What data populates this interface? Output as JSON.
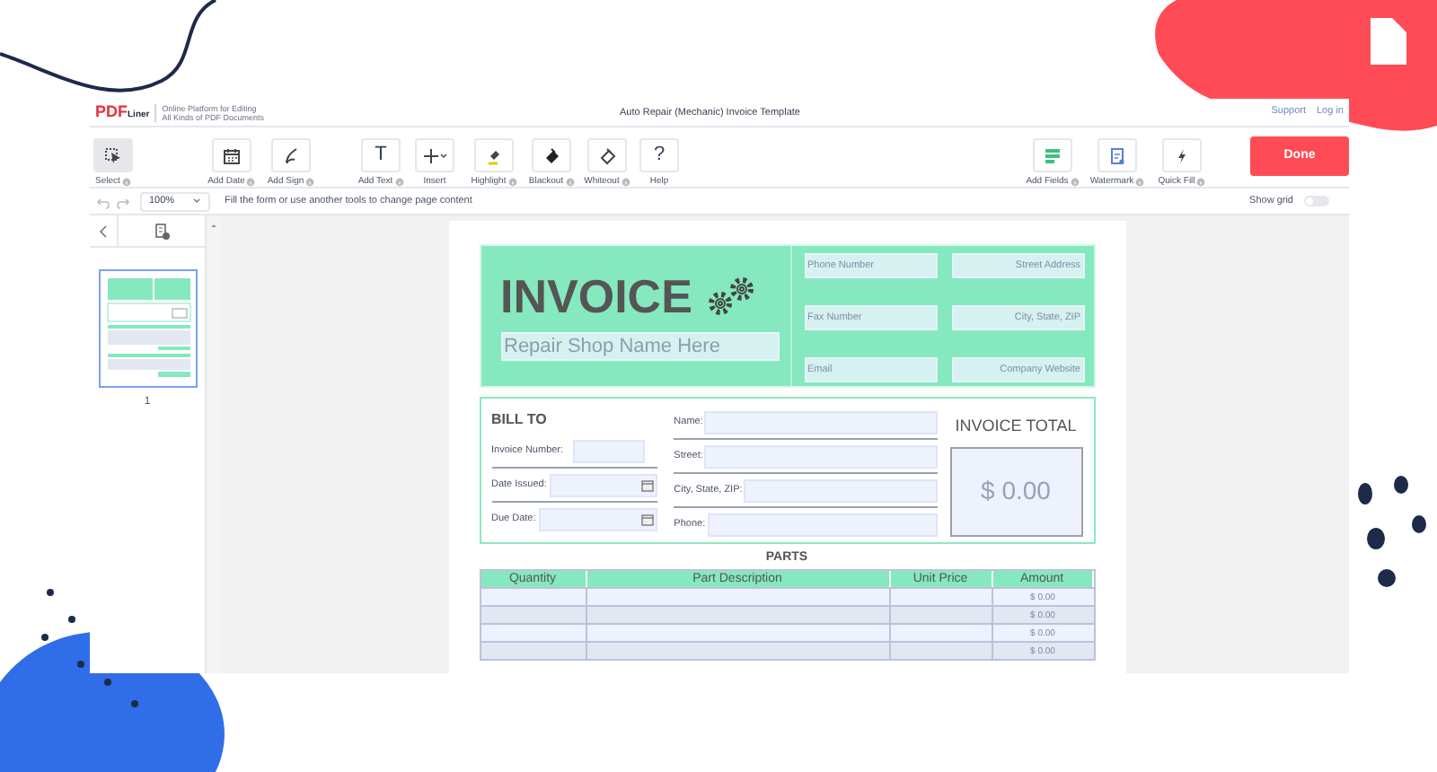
{
  "app_header": {
    "logo": "PDF",
    "logo_suffix": "Liner",
    "tagline": [
      "Online Platform for Editing",
      "All Kinds of PDF Documents"
    ],
    "document_title": "Auto Repair (Mechanic) Invoice Template",
    "links": [
      "Support",
      "Log in"
    ]
  },
  "toolbar": {
    "tools": [
      {
        "kind": "select",
        "label": "Select",
        "info": true,
        "selected": true
      },
      {
        "kind": "date",
        "label": "Add Date",
        "info": true,
        "selected": false
      },
      {
        "kind": "sign",
        "label": "Add Sign",
        "info": true,
        "selected": false
      },
      {
        "kind": "text",
        "label": "Add Text",
        "glyph": "T",
        "info": true,
        "selected": false
      },
      {
        "kind": "insert",
        "label": "Insert",
        "info": false,
        "selected": false
      },
      {
        "kind": "highlight",
        "label": "Highlight",
        "info": true,
        "selected": false
      },
      {
        "kind": "blackout",
        "label": "Blackout",
        "info": true,
        "selected": false
      },
      {
        "kind": "whiteout",
        "label": "Whiteout",
        "info": true,
        "selected": false
      },
      {
        "kind": "help",
        "label": "Help",
        "glyph": "?",
        "info": false,
        "selected": false
      }
    ],
    "right_tools": [
      {
        "kind": "fields",
        "label": "Add Fields",
        "info": true,
        "selected": false
      },
      {
        "kind": "watermark",
        "label": "Watermark",
        "info": true,
        "selected": false
      },
      {
        "kind": "quickfill",
        "label": "Quick Fill",
        "info": true,
        "selected": false
      }
    ],
    "done": "Done"
  },
  "subbar": {
    "zoom": "100%",
    "hint": "Fill the form or use another tools to change page content",
    "show_grid": {
      "label": "Show grid",
      "on": false
    }
  },
  "pages": [
    {
      "label": "1",
      "selected": true
    }
  ],
  "invoice": {
    "title": "INVOICE",
    "shop_name": {
      "placeholder": "Repair Shop Name Here"
    },
    "contact_fields": [
      {
        "placeholder": "Phone Number"
      },
      {
        "placeholder": "Street Address"
      },
      {
        "placeholder": "Fax Number"
      },
      {
        "placeholder": "City, State, ZIP"
      },
      {
        "placeholder": "Email"
      },
      {
        "placeholder": "Company Website"
      }
    ],
    "bill_to": {
      "heading": "BILL TO",
      "left_fields": [
        {
          "label": "Invoice Number:",
          "kind": "text"
        },
        {
          "label": "Date Issued:",
          "kind": "date"
        },
        {
          "label": "Due Date:",
          "kind": "date"
        }
      ],
      "right_fields": [
        {
          "label": "Name:"
        },
        {
          "label": "Street:"
        },
        {
          "label": "City, State, ZIP:"
        },
        {
          "label": "Phone:"
        }
      ]
    },
    "total": {
      "heading": "INVOICE TOTAL",
      "value": "$ 0.00"
    },
    "parts": {
      "heading": "PARTS",
      "columns": [
        "Quantity",
        "Part Description",
        "Unit Price",
        "Amount"
      ],
      "rows": [
        {
          "amount": "$ 0.00"
        },
        {
          "amount": "$ 0.00"
        },
        {
          "amount": "$ 0.00"
        },
        {
          "amount": "$ 0.00"
        }
      ]
    }
  }
}
